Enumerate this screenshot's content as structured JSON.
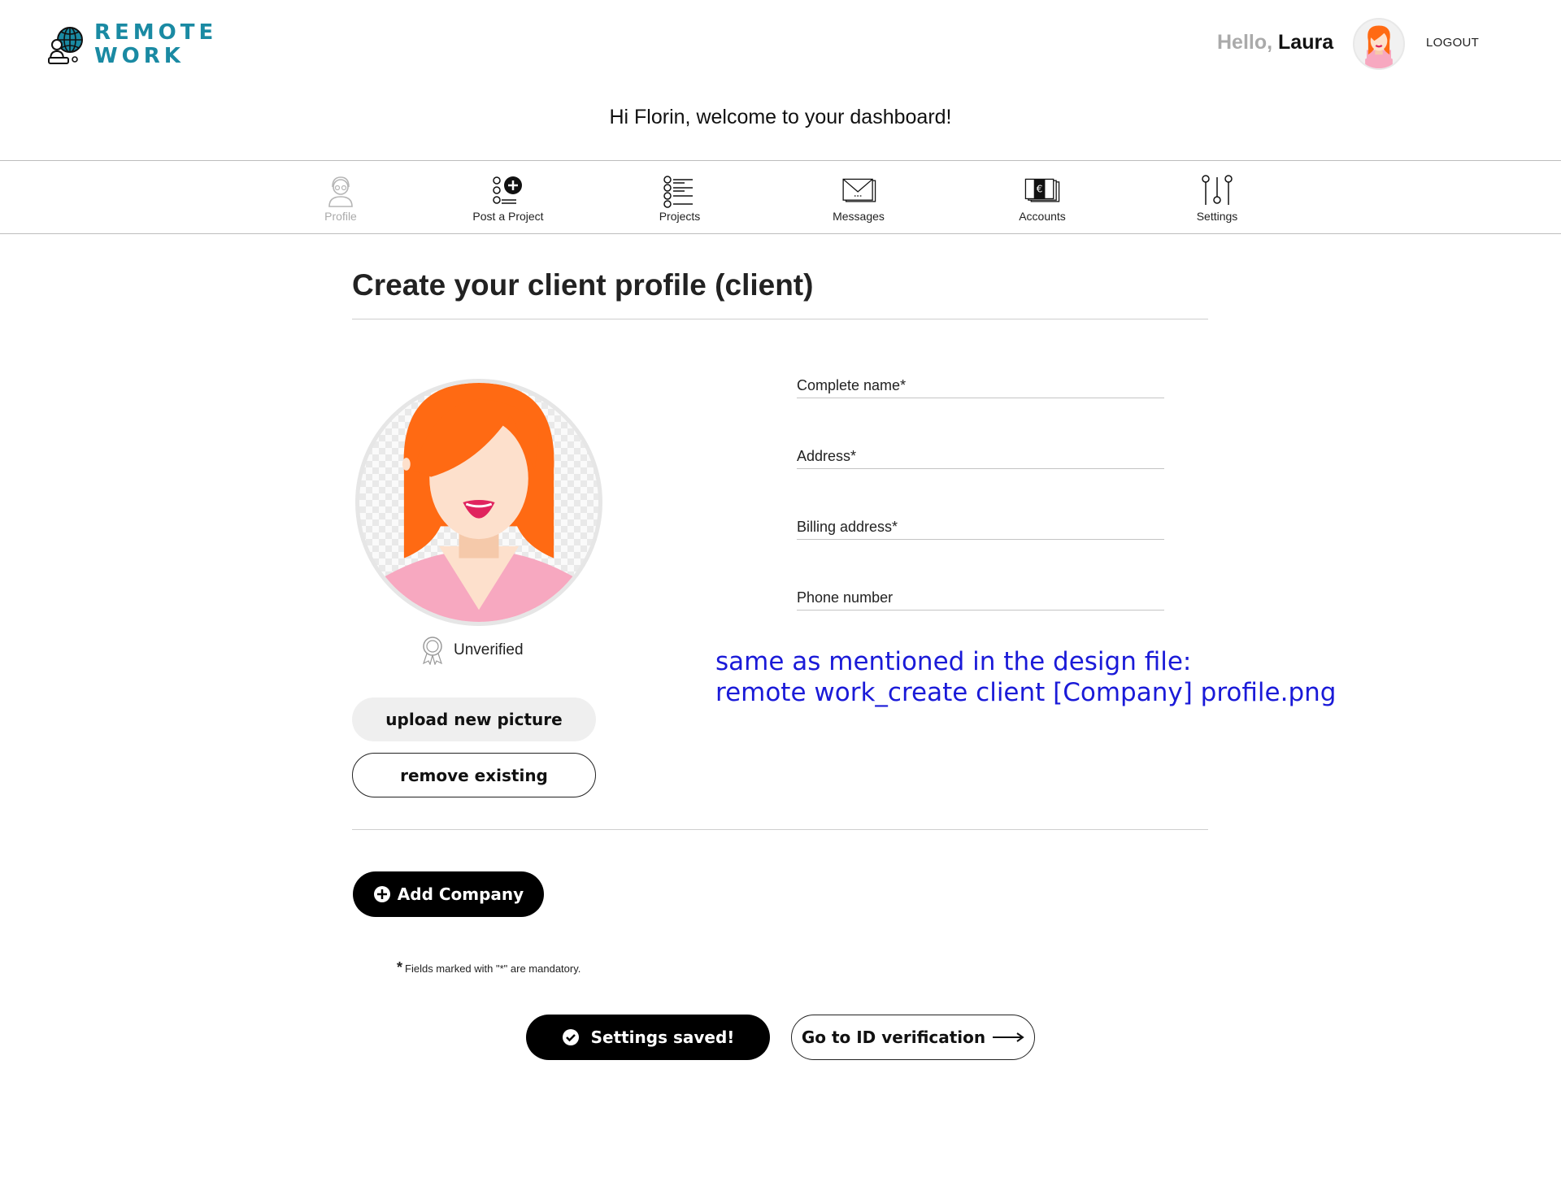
{
  "header": {
    "logo_line1": "REMOTE",
    "logo_line2": "WORK",
    "hello": "Hello,",
    "user_name": "Laura",
    "logout": "LOGOUT",
    "welcome": "Hi Florin, welcome to your dashboard!"
  },
  "nav": {
    "items": [
      {
        "label": "Profile",
        "icon": "profile-icon",
        "active": false
      },
      {
        "label": "Post a Project",
        "icon": "post-project-icon",
        "active": true
      },
      {
        "label": "Projects",
        "icon": "projects-icon",
        "active": true
      },
      {
        "label": "Messages",
        "icon": "messages-icon",
        "active": true
      },
      {
        "label": "Accounts",
        "icon": "accounts-icon",
        "active": true
      },
      {
        "label": "Settings",
        "icon": "settings-icon",
        "active": true
      }
    ]
  },
  "main": {
    "title": "Create your client profile (client)",
    "verification_status": "Unverified",
    "upload_label": "upload new picture",
    "remove_label": "remove existing",
    "fields": [
      {
        "label": "Complete name*",
        "value": ""
      },
      {
        "label": "Address*",
        "value": ""
      },
      {
        "label": "Billing address*",
        "value": ""
      },
      {
        "label": "Phone number",
        "value": ""
      }
    ],
    "note_line1": "same as mentioned in the design file:",
    "note_line2": "remote work_create client [Company] profile.png",
    "add_company_label": "Add Company",
    "mandatory_star": "*",
    "mandatory_text": "Fields marked with \"*\" are mandatory.",
    "settings_saved_label": "Settings saved!",
    "id_verification_label": "Go to ID verification"
  },
  "colors": {
    "brand": "#1a8aa3",
    "note": "#1a1ad8",
    "hair": "#ff6a13",
    "shirt": "#f7a8c0"
  }
}
